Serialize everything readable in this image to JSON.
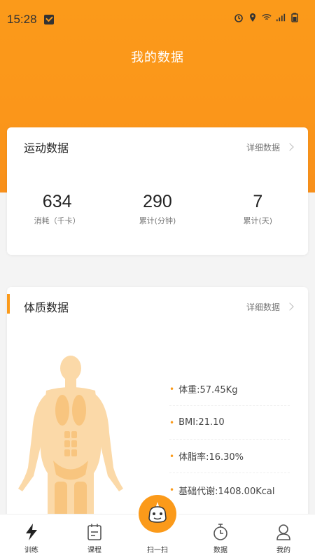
{
  "status_bar": {
    "time": "15:28"
  },
  "page": {
    "title": "我的数据"
  },
  "activity": {
    "title": "运动数据",
    "link": "详细数据",
    "stats": [
      {
        "value": "634",
        "label": "消耗（千卡）"
      },
      {
        "value": "290",
        "label": "累计(分钟)"
      },
      {
        "value": "7",
        "label": "累计(天)"
      }
    ]
  },
  "body": {
    "title": "体质数据",
    "link": "详细数据",
    "metrics": [
      {
        "text": "体重:57.45Kg"
      },
      {
        "text": "BMI:21.10"
      },
      {
        "text": "体脂率:16.30%"
      },
      {
        "text": "基础代谢:1408.00Kcal"
      }
    ]
  },
  "tabbar": {
    "tabs": [
      {
        "label": "训练",
        "icon": "lightning-icon"
      },
      {
        "label": "课程",
        "icon": "calendar-icon"
      },
      {
        "label": "扫一扫",
        "icon": "unicorn-scan-icon"
      },
      {
        "label": "数据",
        "icon": "timer-icon"
      },
      {
        "label": "我的",
        "icon": "person-icon"
      }
    ]
  },
  "colors": {
    "accent": "#fb9a1a",
    "background": "#f4f4f4"
  }
}
